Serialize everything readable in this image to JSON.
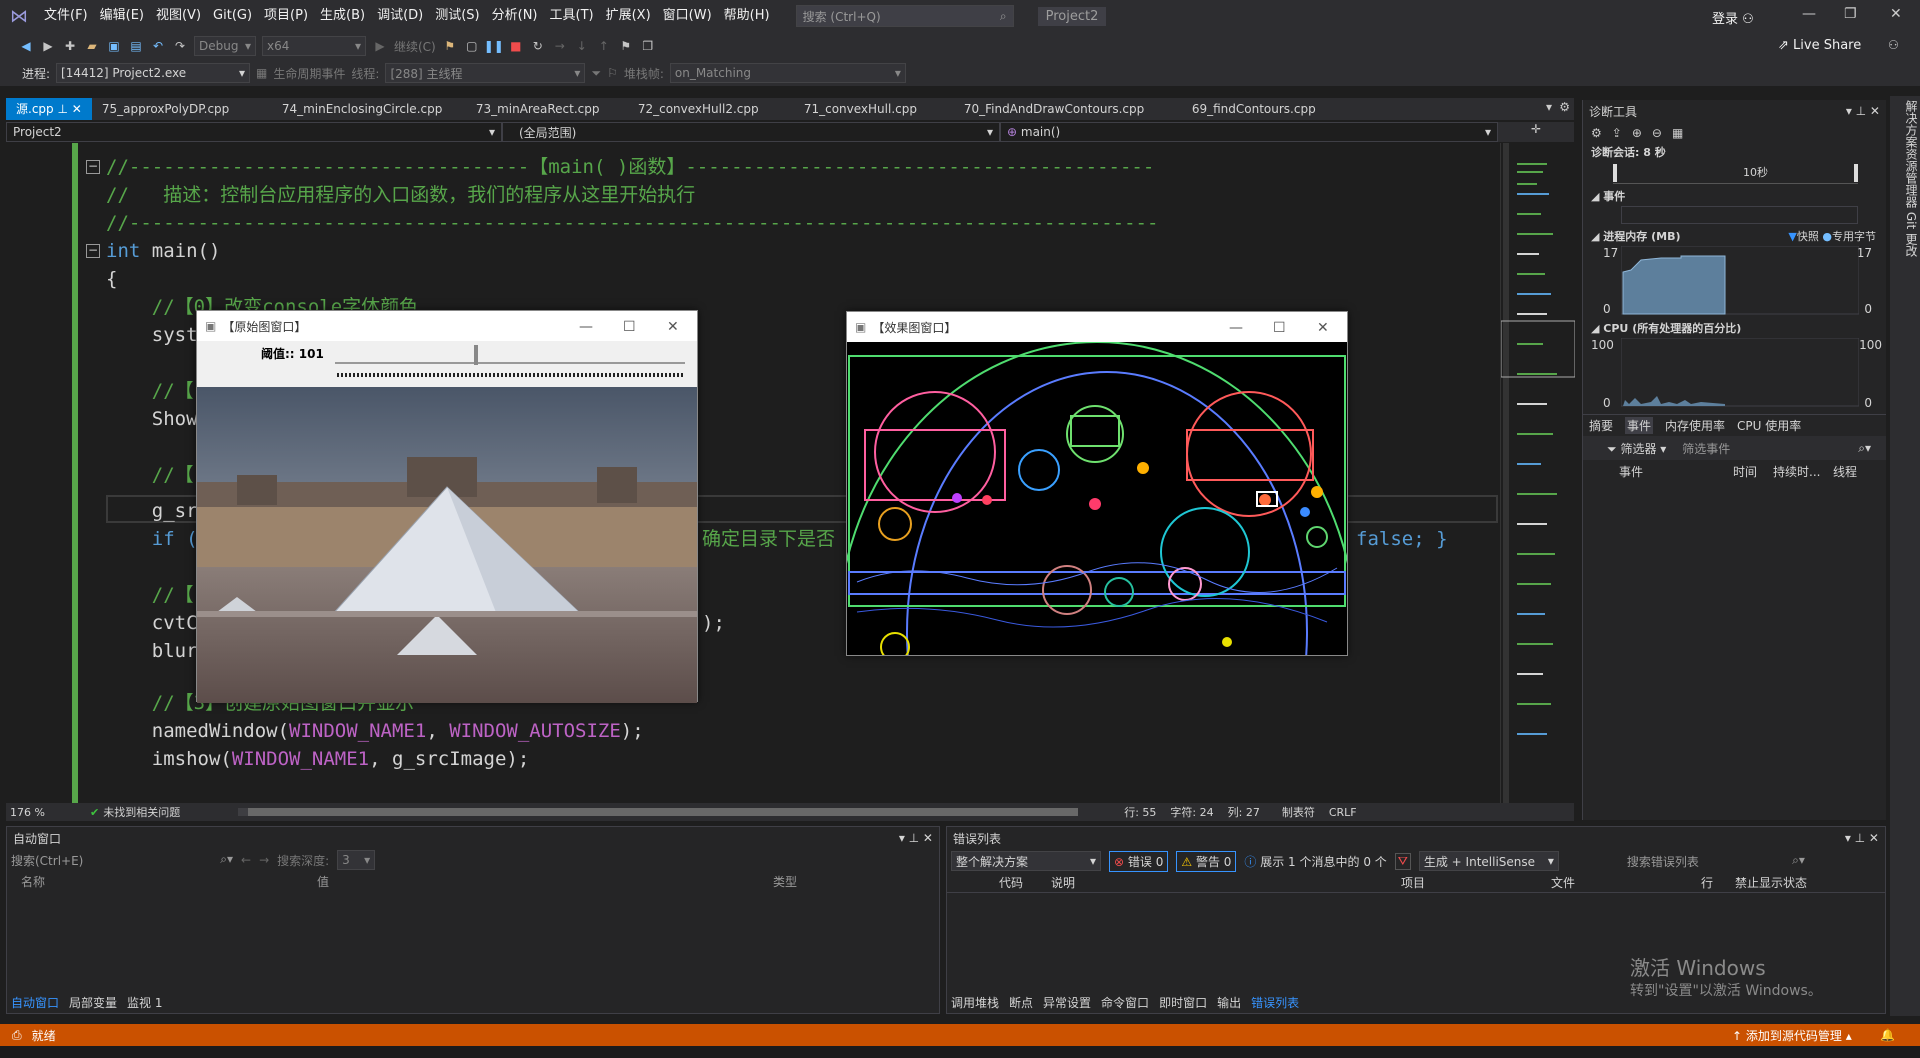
{
  "menu": {
    "items": [
      "文件(F)",
      "编辑(E)",
      "视图(V)",
      "Git(G)",
      "项目(P)",
      "生成(B)",
      "调试(D)",
      "测试(S)",
      "分析(N)",
      "工具(T)",
      "扩展(X)",
      "窗口(W)",
      "帮助(H)"
    ],
    "search_placeholder": "搜索 (Ctrl+Q)",
    "project": "Project2",
    "login": "登录"
  },
  "toolbar": {
    "config": "Debug",
    "platform": "x64",
    "continue": "继续(C)",
    "live_share": "Live Share"
  },
  "toolbar2": {
    "process_label": "进程:",
    "process": "[14412] Project2.exe",
    "lifecycle": "生命周期事件",
    "thread_label": "线程:",
    "thread": "[288] 主线程",
    "stack_label": "堆栈帧:",
    "stack": "on_Matching"
  },
  "tabs": [
    "源.cpp",
    "75_approxPolyDP.cpp",
    "74_minEnclosingCircle.cpp",
    "73_minAreaRect.cpp",
    "72_convexHull2.cpp",
    "71_convexHull.cpp",
    "70_FindAndDrawContours.cpp",
    "69_findContours.cpp"
  ],
  "nav": {
    "project": "Project2",
    "scope": "(全局范围)",
    "member": "main()"
  },
  "code": {
    "l1": "//-----------------------------------【main( )函数】-----------------------------------------",
    "l2": "//   描述：控制台应用程序的入口函数，我们的程序从这里开始执行",
    "l3": "//------------------------------------------------------------------------------------------",
    "l4a": "int",
    "l4b": " main()",
    "l5": "{",
    "l6": "    //【0】改变console字体颜色",
    "l7": "    syst",
    "l9": "    //【",
    "l10": "    Show",
    "l12": "    //【",
    "l13": "    g_sr",
    "l14a": "    if (",
    "l14b": "确定目录下是否",
    "l14c": "false; }",
    "l16": "    //【",
    "l17": "    cvtC",
    "l17b": ");",
    "l18": "    blur",
    "l20": "    //【3】创建原始图窗口并显示",
    "l21a": "    namedWindow(",
    "l21b": "WINDOW_NAME1",
    "l21c": ", ",
    "l21d": "WINDOW_AUTOSIZE",
    "l21e": ");",
    "l22a": "    imshow(",
    "l22b": "WINDOW_NAME1",
    "l22c": ", g_srcImage);"
  },
  "editor_status": {
    "zoom": "176 %",
    "issues": "未找到相关问题",
    "line": "行: 55",
    "char": "字符: 24",
    "col": "列: 27",
    "tab": "制表符",
    "eol": "CRLF"
  },
  "ocv1": {
    "title": "【原始图窗口】",
    "slider_label": "阈值:: 101",
    "threshold": 101,
    "threshold_max": 255
  },
  "ocv2": {
    "title": "【效果图窗口】"
  },
  "diag": {
    "title": "诊断工具",
    "session": "诊断会话: 8 秒",
    "timeline": "10秒",
    "events": "事件",
    "memory": "进程内存 (MB)",
    "snapshot": "快照",
    "private": "专用字节",
    "mem_max": "17",
    "mem_min": "0",
    "cpu": "CPU (所有处理器的百分比)",
    "cpu_max": "100",
    "cpu_min": "0",
    "tabs": [
      "摘要",
      "事件",
      "内存使用率",
      "CPU 使用率"
    ],
    "filter": "筛选器",
    "filter_placeholder": "筛选事件",
    "cols": [
      "事件",
      "时间",
      "持续时...",
      "线程"
    ]
  },
  "right_strip": "解决方案资源管理器  Git 更改",
  "autos": {
    "title": "自动窗口",
    "search": "搜索(Ctrl+E)",
    "depth_label": "搜索深度:",
    "depth": "3",
    "cols": [
      "名称",
      "值",
      "类型"
    ],
    "tabs": [
      "自动窗口",
      "局部变量",
      "监视 1"
    ]
  },
  "errors": {
    "title": "错误列表",
    "scope": "整个解决方案",
    "err": "错误 0",
    "warn": "警告 0",
    "msg": "展示 1 个消息中的 0 个",
    "build": "生成 + IntelliSense",
    "search": "搜索错误列表",
    "cols": [
      "代码",
      "说明",
      "项目",
      "文件",
      "行",
      "禁止显示状态"
    ],
    "tabs": [
      "调用堆栈",
      "断点",
      "异常设置",
      "命令窗口",
      "即时窗口",
      "输出",
      "错误列表"
    ]
  },
  "activate": {
    "line1": "激活 Windows",
    "line2": "转到\"设置\"以激活 Windows。"
  },
  "status": {
    "ready": "就绪",
    "source": "添加到源代码管理"
  }
}
